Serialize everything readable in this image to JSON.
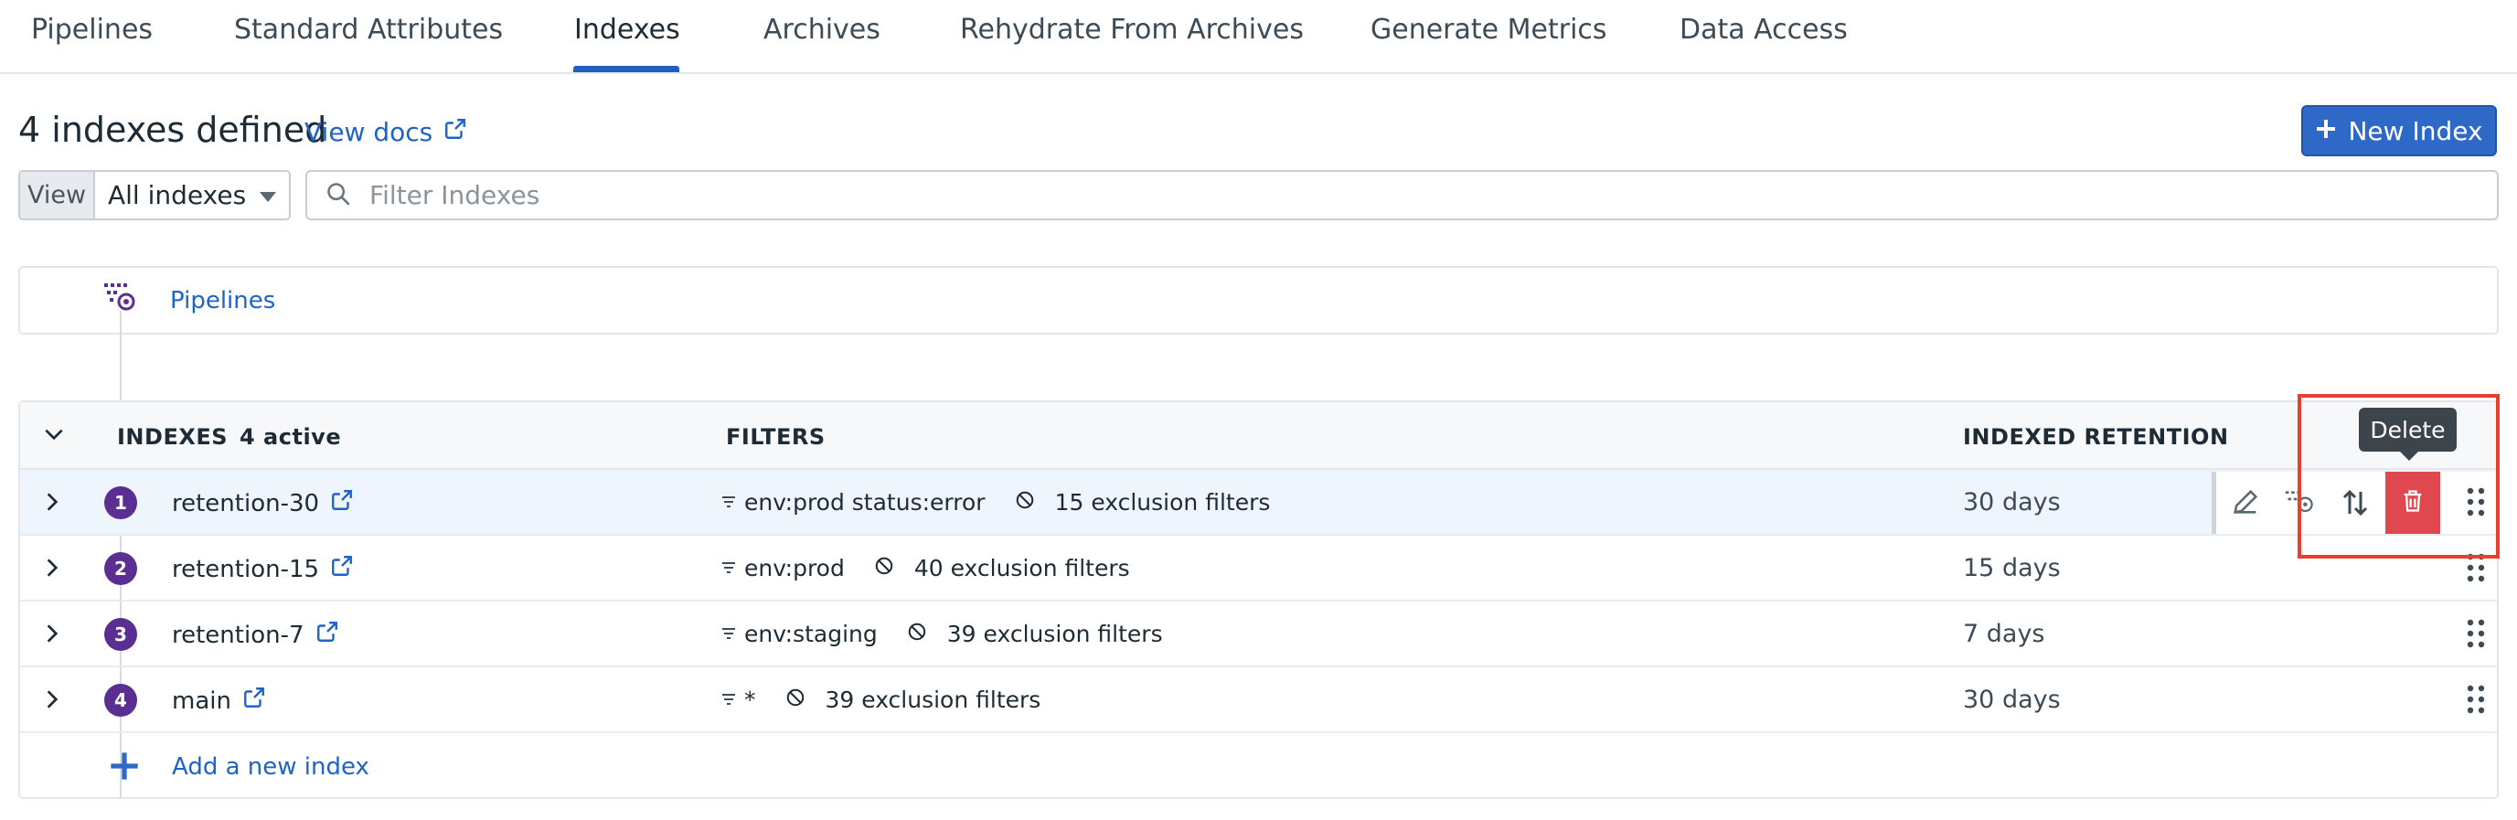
{
  "tabs": [
    {
      "label": "Pipelines"
    },
    {
      "label": "Standard Attributes"
    },
    {
      "label": "Indexes"
    },
    {
      "label": "Archives"
    },
    {
      "label": "Rehydrate From Archives"
    },
    {
      "label": "Generate Metrics"
    },
    {
      "label": "Data Access"
    }
  ],
  "active_tab": "Indexes",
  "header": {
    "title": "4 indexes defined",
    "view_docs": "View docs",
    "new_index_label": "New Index"
  },
  "view_selector": {
    "label": "View",
    "selected": "All indexes"
  },
  "search": {
    "placeholder": "Filter Indexes",
    "value": ""
  },
  "pipelines": {
    "label": "Pipelines"
  },
  "table": {
    "headers": {
      "indexes": "INDEXES",
      "active_count": "4 active",
      "filters": "FILTERS",
      "retention": "INDEXED RETENTION"
    },
    "rows": [
      {
        "order": "1",
        "name": "retention-30",
        "query": "env:prod status:error",
        "exclusions": "15 exclusion filters",
        "retention": "30 days"
      },
      {
        "order": "2",
        "name": "retention-15",
        "query": "env:prod",
        "exclusions": "40 exclusion filters",
        "retention": "15 days"
      },
      {
        "order": "3",
        "name": "retention-7",
        "query": "env:staging",
        "exclusions": "39 exclusion filters",
        "retention": "7 days"
      },
      {
        "order": "4",
        "name": "main",
        "query": "*",
        "exclusions": "39 exclusion filters",
        "retention": "30 days"
      }
    ],
    "add_label": "Add a new index"
  },
  "tooltip": {
    "text": "Delete"
  },
  "icons": {
    "external_link": "external-link-icon",
    "filter": "filter-lines-icon",
    "exclusion": "no-entry-icon",
    "drag": "drag-handle-icon",
    "edit": "pencil-icon",
    "pipeline": "pipeline-icon",
    "reorder": "sort-arrows-icon",
    "delete": "trash-icon",
    "add": "plus-icon"
  },
  "colors": {
    "accent": "#2e69c8",
    "link": "#1e63c6",
    "badge": "#5b2e91",
    "delete": "#e0484f",
    "annotation": "#e8402e"
  }
}
